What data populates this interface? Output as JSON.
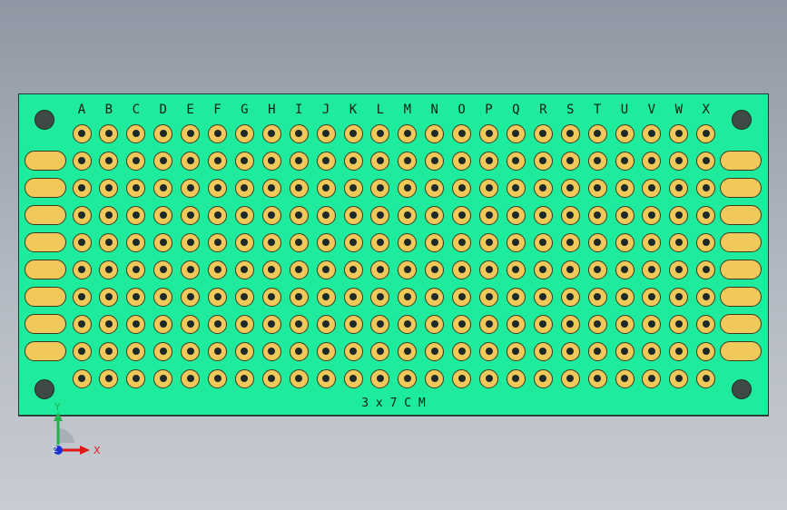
{
  "board": {
    "columns": [
      "A",
      "B",
      "C",
      "D",
      "E",
      "F",
      "G",
      "H",
      "I",
      "J",
      "K",
      "L",
      "M",
      "N",
      "O",
      "P",
      "Q",
      "R",
      "S",
      "T",
      "U",
      "V",
      "W",
      "X"
    ],
    "row_count": 10,
    "side_pad_rows": 8,
    "mounting_holes": 4,
    "label": "3 x 7 C M",
    "colors": {
      "board": "#1eec9c",
      "pad": "#f1c95a",
      "drill": "#1f2a28",
      "mounting_hole": "#3f4a47",
      "outline": "#1e3a32"
    }
  },
  "triad": {
    "x_label": "X",
    "y_label": "Y",
    "z_label": "Z",
    "colors": {
      "x": "#e01818",
      "y": "#22b24c",
      "z": "#1a2fd6"
    }
  }
}
